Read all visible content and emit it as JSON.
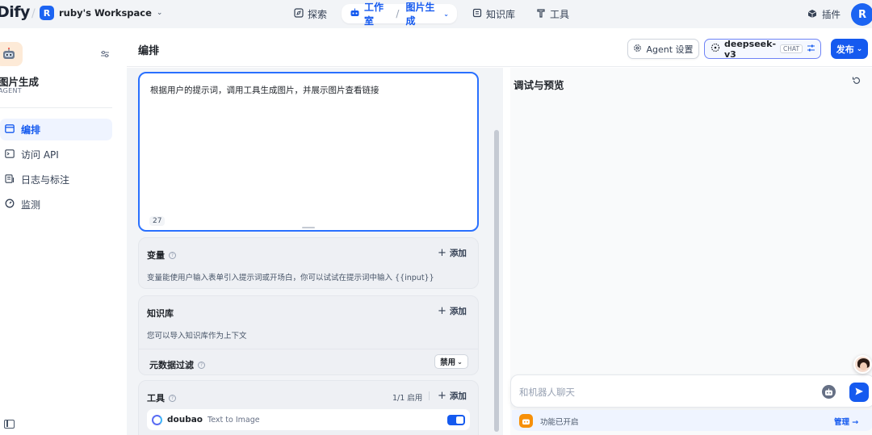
{
  "topbar": {
    "logo": "Dify",
    "workspace_badge": "R",
    "workspace_name": "ruby's Workspace",
    "nav": {
      "explore": "探索",
      "studio": "工作室",
      "current_app": "图片生成",
      "knowledge": "知识库",
      "tools": "工具"
    },
    "plugins": "插件",
    "avatar": "R"
  },
  "sidebar": {
    "app_name": "图片生成",
    "app_type": "AGENT",
    "items": [
      {
        "label": "编排",
        "icon": "layout-icon",
        "active": true
      },
      {
        "label": "访问 API",
        "icon": "terminal-icon",
        "active": false
      },
      {
        "label": "日志与标注",
        "icon": "log-icon",
        "active": false
      },
      {
        "label": "监测",
        "icon": "gauge-icon",
        "active": false
      }
    ]
  },
  "header": {
    "title": "编排",
    "agent_settings": "Agent 设置",
    "model_name": "deepseek-v3",
    "model_tag": "CHAT",
    "publish": "发布"
  },
  "prompt": {
    "text": "根据用户的提示词，调用工具生成图片，并展示图片查看链接",
    "char_count": "27"
  },
  "variables": {
    "title": "变量",
    "add": "添加",
    "description": "变量能使用户输入表单引入提示词或开场白，你可以试试在提示词中输入 {{input}}"
  },
  "knowledge": {
    "title": "知识库",
    "add": "添加",
    "description": "您可以导入知识库作为上下文",
    "metadata_filter": "元数据过滤",
    "metadata_value": "禁用"
  },
  "tools": {
    "title": "工具",
    "enabled_count": "1/1 启用",
    "add": "添加",
    "items": [
      {
        "name": "doubao",
        "subtitle": "Text to Image",
        "enabled": true
      }
    ]
  },
  "debug": {
    "title": "调试与预览",
    "input_placeholder": "和机器人聊天",
    "features_text": "功能已开启",
    "manage": "管理 →"
  },
  "colors": {
    "accent": "#155aef",
    "prompt_border": "#2970ff",
    "feature_icon": "#f79009"
  }
}
